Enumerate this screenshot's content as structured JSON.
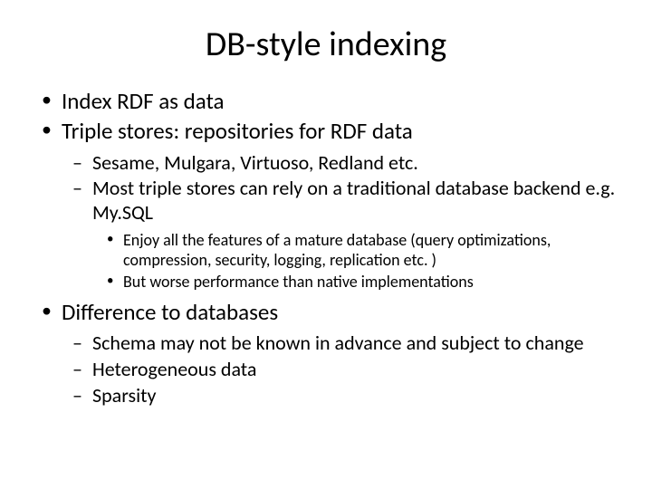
{
  "title": "DB-style indexing",
  "bullets": {
    "b1": "Index RDF as data",
    "b2": "Triple stores: repositories for RDF data",
    "b2_1": "Sesame, Mulgara, Virtuoso, Redland etc.",
    "b2_2": "Most triple stores can rely on a traditional database backend e.g. My.SQL",
    "b2_2_1": "Enjoy all the features of a mature database (query optimizations, compression, security, logging, replication etc. )",
    "b2_2_2": "But worse performance than native implementations",
    "b3": "Difference to databases",
    "b3_1": "Schema may not be known in advance and subject to change",
    "b3_2": "Heterogeneous data",
    "b3_3": "Sparsity"
  }
}
